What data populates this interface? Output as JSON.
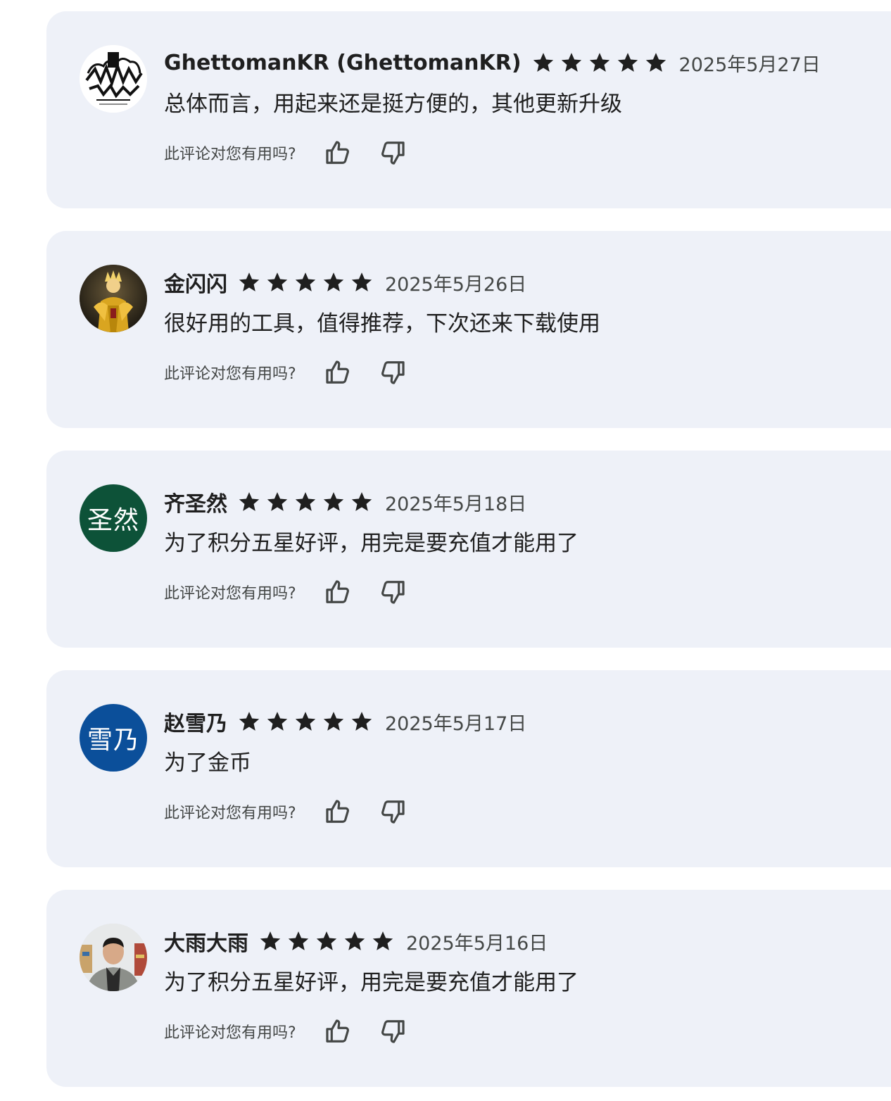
{
  "reviews": [
    {
      "name": "GhettomanKR (GhettomanKR)",
      "rating": 5,
      "date": "2025年5月27日",
      "text": "总体而言，用起来还是挺方便的，其他更新升级",
      "helpful_prompt": "此评论对您有用吗?",
      "avatar": {
        "type": "image",
        "icon": "graffiti-logo-avatar",
        "bg": "#ffffff"
      }
    },
    {
      "name": "金闪闪",
      "rating": 5,
      "date": "2025年5月26日",
      "text": "很好用的工具，值得推荐，下次还来下载使用",
      "helpful_prompt": "此评论对您有用吗?",
      "avatar": {
        "type": "image",
        "icon": "golden-knight-avatar",
        "bg": "#3a2f1e"
      }
    },
    {
      "name": "齐圣然",
      "rating": 5,
      "date": "2025年5月18日",
      "text": "为了积分五星好评，用完是要充值才能用了",
      "helpful_prompt": "此评论对您有用吗?",
      "avatar": {
        "type": "text",
        "label": "圣然",
        "bg": "#0d5238"
      }
    },
    {
      "name": "赵雪乃",
      "rating": 5,
      "date": "2025年5月17日",
      "text": "为了金币",
      "helpful_prompt": "此评论对您有用吗?",
      "avatar": {
        "type": "text",
        "label": "雪乃",
        "bg": "#0b4f9a"
      }
    },
    {
      "name": "大雨大雨",
      "rating": 5,
      "date": "2025年5月16日",
      "text": "为了积分五星好评，用完是要充值才能用了",
      "helpful_prompt": "此评论对您有用吗?",
      "avatar": {
        "type": "image",
        "icon": "person-photo-avatar",
        "bg": "#d9dde0"
      }
    }
  ],
  "colors": {
    "card_bg": "#eef1f8",
    "star": "#1f1f1f",
    "text_primary": "#1f1f1f",
    "text_secondary": "#444746"
  },
  "icons": {
    "star": "star-icon",
    "helpful_yes": "thumbs-up-icon",
    "helpful_no": "thumbs-down-icon"
  }
}
